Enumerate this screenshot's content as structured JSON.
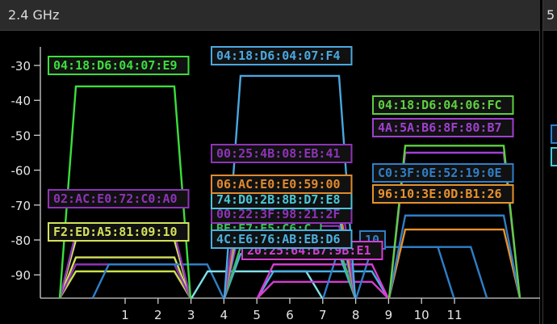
{
  "window": {
    "panel_title": "2.4 GHz",
    "side_panel_title": "5"
  },
  "chart_data": {
    "type": "area",
    "title": "2.4 GHz",
    "xlabel": "",
    "ylabel": "",
    "x_ticks": [
      1,
      2,
      3,
      4,
      5,
      6,
      7,
      8,
      9,
      10,
      11
    ],
    "y_ticks": [
      -30,
      -40,
      -50,
      -60,
      -70,
      -80,
      -90
    ],
    "xlim": [
      -1.7,
      13.9
    ],
    "ylim": [
      -100,
      -22
    ],
    "grid": false,
    "legend": "labels on series",
    "series": [
      {
        "name": "04:18:D6:04:07:E9",
        "color": "#3cde3c",
        "channel": 1,
        "level": -36
      },
      {
        "name": "04:18:D6:04:07:F4",
        "color": "#4aa8e0",
        "channel": 6,
        "level": -33
      },
      {
        "name": "04:18:D6:04:06:FC",
        "color": "#5ed040",
        "channel": 11,
        "level": -53
      },
      {
        "name": "4A:5A:B6:8F:80:B7",
        "color": "#a040d0",
        "channel": 11,
        "level": -55
      },
      {
        "name": "00:25:4B:08:EB:41",
        "color": "#8e33b8",
        "channel": 6,
        "level": -63
      },
      {
        "name": "06:AC:E0:E0:59:00",
        "color": "#e08a30",
        "channel": 6,
        "level": -70
      },
      {
        "name": "74:D0:2B:8B:D7:E8",
        "color": "#4ac8d8",
        "channel": 6,
        "level": -73
      },
      {
        "name": "C0:3F:0E:52:19:0E",
        "color": "#2f7fc8",
        "channel": 11,
        "level": -73
      },
      {
        "name": "96:10:3E:0D:B1:26",
        "color": "#e8922c",
        "channel": 11,
        "level": -77
      },
      {
        "name": "02:AC:E0:72:C0:A0",
        "color": "#8e33b8",
        "channel": 1,
        "level": -78
      },
      {
        "name": "00:22:3F:98:21:2F",
        "color": "#8e33b8",
        "channel": 6,
        "level": -76
      },
      {
        "name": "F2:ED:A5:81:09:10",
        "color": "#d4e25a",
        "channel": 1,
        "level": -80
      },
      {
        "name": "BE:F7:F5:C6:C",
        "color": "#3cbd5c",
        "channel": 6,
        "level": -82
      },
      {
        "name": "4C:E6:76:AB:EB:D6",
        "color": "#4ab0e0",
        "channel": 6,
        "level": -84
      },
      {
        "name": "20:25:64:B7:9B:E1",
        "color": "#d43ed0",
        "channel": 7,
        "level": -87
      },
      {
        "name": "10",
        "color": "#2f7fc8",
        "channel": 9,
        "level": -82
      }
    ],
    "other_networks": [
      {
        "color": "#c8e04a",
        "channel": 1,
        "level": -89
      },
      {
        "color": "#d4e25a",
        "channel": 1,
        "level": -85
      },
      {
        "color": "#8e33b8",
        "channel": 1,
        "level": -87
      },
      {
        "color": "#2f7fc8",
        "channel": 2,
        "level": -87
      },
      {
        "color": "#80e0e8",
        "channel": 5,
        "level": -89
      },
      {
        "color": "#4ab0e0",
        "channel": 7,
        "level": -89
      },
      {
        "color": "#d43ed0",
        "channel": 7,
        "level": -92
      },
      {
        "color": "#2f7fc8",
        "channel": 10,
        "level": -82
      }
    ]
  }
}
